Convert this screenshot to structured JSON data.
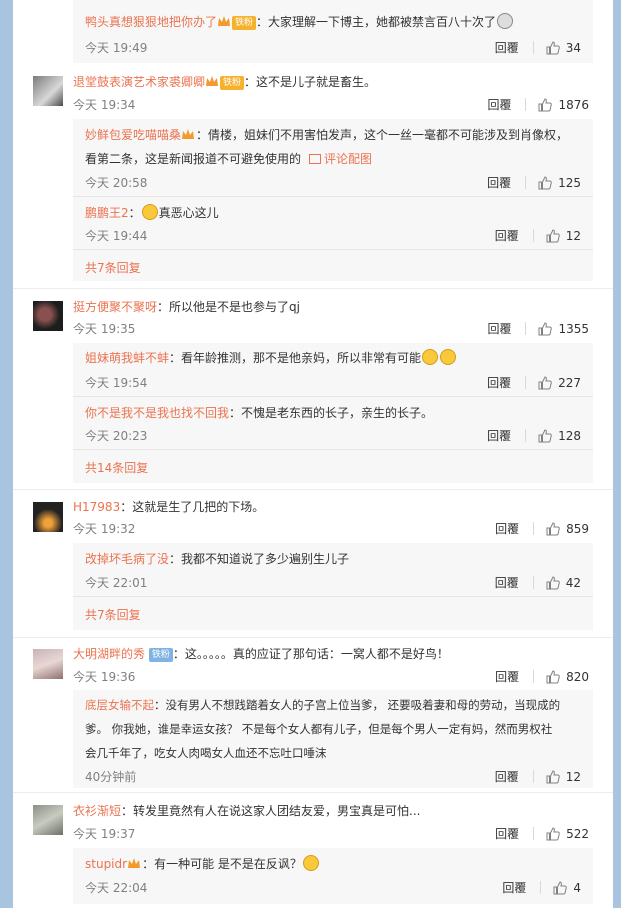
{
  "ui": {
    "reply_label": "回覆",
    "pic_link_label": "评论配图",
    "fan_badge": "铁粉",
    "iron_badge": "铁粉"
  },
  "top_reply": {
    "name": "鸭头真想狠狠地把你办了",
    "text": "：大家理解一下博主，她都被禁言百八十次了",
    "time": "今天 19:49",
    "likes": "34"
  },
  "comments": [
    {
      "name": "退堂鼓表演艺术家裘卿卿",
      "text": "：这不是儿子就是畜生。",
      "time": "今天 19:34",
      "likes": "1876",
      "replies": [
        {
          "name": "妙鲜包爱吃喵喵桑",
          "text_line1": "：倩楼，姐妹们不用害怕发声，这个一丝一毫都不可能涉及到肖像权，",
          "text_line2": "看第二条，这是新闻报道不可避免使用的",
          "time": "今天 20:58",
          "likes": "125"
        },
        {
          "name": "鹏鹏王2",
          "text": "真恶心这儿",
          "time": "今天 19:44",
          "likes": "12"
        }
      ],
      "more": "共7条回复"
    },
    {
      "name": "挺方便聚不聚呀",
      "text": "：所以他是不是也参与了qj",
      "time": "今天 19:35",
      "likes": "1355",
      "replies": [
        {
          "name": "姐妹萌我蚌不蚌",
          "text": "：看年龄推测，那不是他亲妈，所以非常有可能",
          "time": "今天 19:54",
          "likes": "227"
        },
        {
          "name": "你不是我不是我也找不回我",
          "text": "：不愧是老东西的长子，亲生的长子。",
          "time": "今天 20:23",
          "likes": "128"
        }
      ],
      "more": "共14条回复"
    },
    {
      "name": "H17983",
      "text": "：这就是生了几把的下场。",
      "time": "今天 19:32",
      "likes": "859",
      "replies": [
        {
          "name": "改掉坏毛病了没",
          "text": "：我都不知道说了多少遍别生儿子",
          "time": "今天 22:01",
          "likes": "42"
        }
      ],
      "more": "共7条回复"
    },
    {
      "name": "大明湖畔的秀",
      "text": "：这。。。。。真的应证了那句话：一窝人都不是好鸟！",
      "time": "今天 19:36",
      "likes": "820",
      "replies": [
        {
          "name": "底层女输不起",
          "text_line1": "：没有男人不想践踏着女人的子宫上位当爹， 还要吸着妻和母的劳动，当现成的",
          "text_line2": "爹。 你我她，谁是幸运女孩？  不是每个女人都有儿子，但是每个男人一定有妈，然而男权社",
          "text_line3": "会几千年了，吃女人肉喝女人血还不忘吐口唾沫",
          "time": "40分钟前",
          "likes": "12"
        }
      ]
    },
    {
      "name": "衣衫渐短",
      "text": "：转发里竟然有人在说这家人团结友爱，男宝真是可怕...",
      "time": "今天 19:37",
      "likes": "522",
      "replies": [
        {
          "name": "stupidr",
          "text": "：有一种可能 是不是在反讽？",
          "time": "今天 22:04",
          "likes": "4"
        }
      ]
    }
  ]
}
